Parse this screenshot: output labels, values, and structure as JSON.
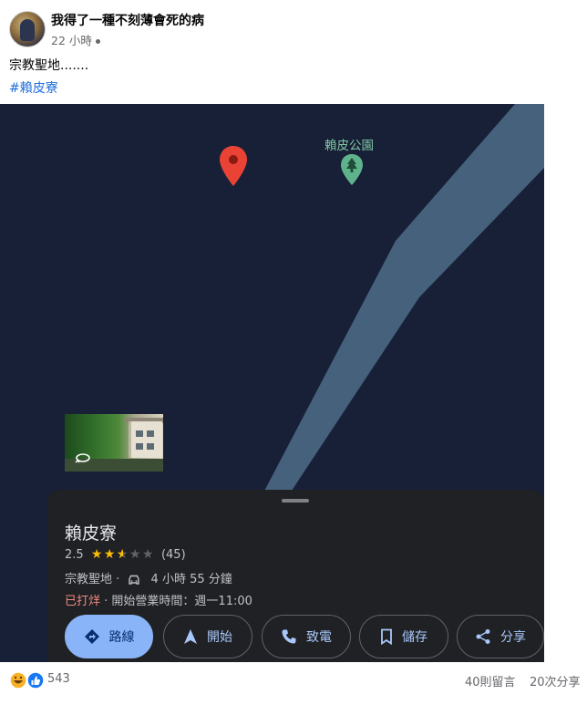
{
  "post": {
    "page_name": "我得了一種不刻薄會死的病",
    "time": "22 小時",
    "text": "宗教聖地.......",
    "hashtag": "#賴皮寮"
  },
  "map": {
    "park_label": "賴皮公園"
  },
  "place": {
    "title": "賴皮寮",
    "rating": "2.5",
    "rating_value": 2.5,
    "review_count": "(45)",
    "category": "宗教聖地 ·",
    "travel_time": "4 小時 55 分鐘",
    "status_closed": "已打烊",
    "status_rest": "· 開始營業時間：週一11:00"
  },
  "actions": [
    {
      "label": "路線",
      "icon": "directions-icon"
    },
    {
      "label": "開始",
      "icon": "navigation-icon"
    },
    {
      "label": "致電",
      "icon": "phone-icon"
    },
    {
      "label": "儲存",
      "icon": "bookmark-icon"
    },
    {
      "label": "分享",
      "icon": "share-icon"
    }
  ],
  "footer": {
    "reaction_count": "543",
    "comments": "40則留言",
    "shares": "20次分享"
  },
  "colors": {
    "map_bg": "#172036",
    "road": "#46617c",
    "pin_red": "#ea4335",
    "park_green": "#5fb38c",
    "star": "#fbbc04",
    "primary_button": "#8ab4f8",
    "closed_text": "#f28b82"
  }
}
